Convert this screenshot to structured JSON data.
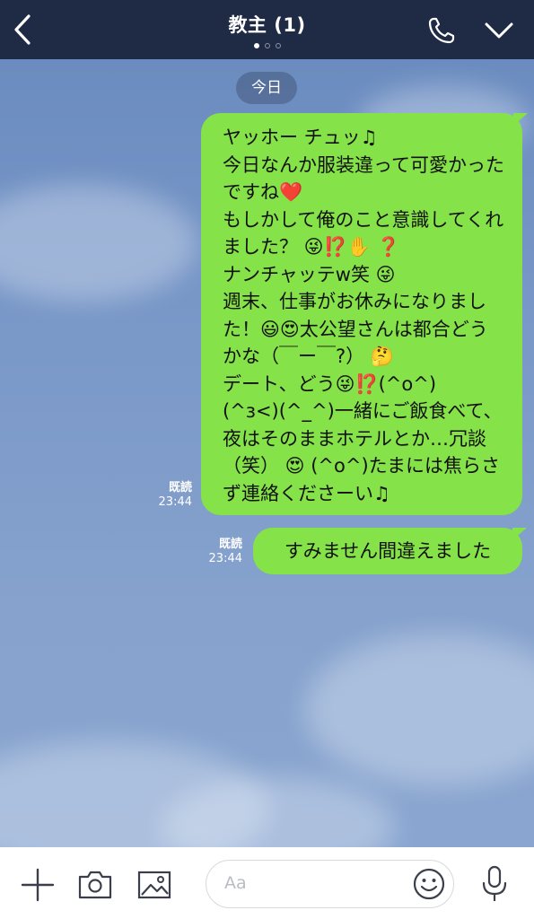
{
  "header": {
    "title": "教主 (1)"
  },
  "chat": {
    "date_label": "今日",
    "messages": [
      {
        "text": "ヤッホー チュッ♫\n今日なんか服装違って可愛かったですね❤️\nもしかして俺のこと意識してくれました？ 😜⁉️✋ ❓\nナンチャッテw笑 😜\n週末、仕事がお休みになりました！😃😍太公望さんは都合どうかな（￣ー￣?） 🤔\nデート、どう😜⁉️(^o^)\n(^з<)(^_^)一緒にご飯食べて、夜はそのままホテルとか…冗談（笑） 😍 (^o^)たまには焦らさず連絡くださーい♫",
        "read": "既読",
        "time": "23:44"
      },
      {
        "text": "すみません間違えました",
        "read": "既読",
        "time": "23:44"
      }
    ]
  },
  "input": {
    "placeholder": "Aa"
  },
  "colors": {
    "header_bg": "#1f2a44",
    "bubble_green": "#85e249",
    "chat_bg": "#7a98c8"
  },
  "icons": {
    "back": "chevron-left-icon",
    "call": "phone-icon",
    "menu": "chevron-down-icon",
    "plus": "plus-icon",
    "camera": "camera-icon",
    "image": "image-icon",
    "emoji": "smile-icon",
    "voice": "microphone-icon"
  }
}
